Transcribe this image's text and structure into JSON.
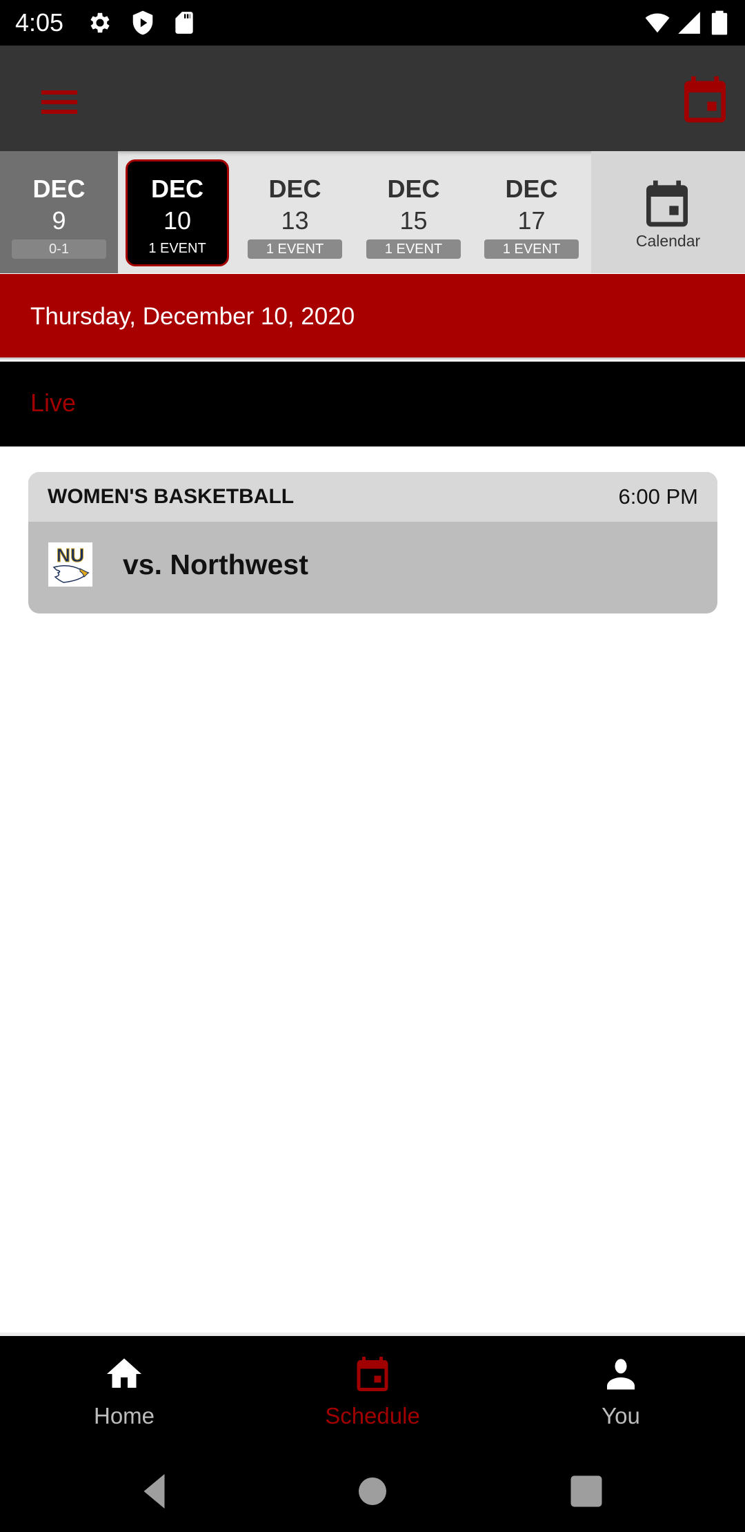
{
  "status_bar": {
    "time": "4:05",
    "left_icons": [
      "gear-icon",
      "shield-play-icon",
      "sd-card-icon"
    ],
    "right_icons": [
      "wifi-icon",
      "signal-icon",
      "battery-icon"
    ]
  },
  "header": {
    "menu_icon": "hamburger-menu-icon",
    "calendar_icon": "calendar-icon",
    "accent_color": "#a50000"
  },
  "date_strip": {
    "dates": [
      {
        "month": "DEC",
        "day": "9",
        "badge": "0-1",
        "state": "past"
      },
      {
        "month": "DEC",
        "day": "10",
        "badge": "1 EVENT",
        "state": "selected"
      },
      {
        "month": "DEC",
        "day": "13",
        "badge": "1 EVENT",
        "state": "upcoming"
      },
      {
        "month": "DEC",
        "day": "15",
        "badge": "1 EVENT",
        "state": "upcoming"
      },
      {
        "month": "DEC",
        "day": "17",
        "badge": "1 EVENT",
        "state": "upcoming"
      }
    ],
    "calendar_label": "Calendar"
  },
  "date_banner": {
    "text": "Thursday, December 10, 2020"
  },
  "live_bar": {
    "label": "Live"
  },
  "events": [
    {
      "sport": "WOMEN'S BASKETBALL",
      "time": "6:00 PM",
      "opponent": "vs. Northwest",
      "logo_text": "NU"
    }
  ],
  "bottom_nav": {
    "items": [
      {
        "label": "Home",
        "icon": "home-icon",
        "active": false
      },
      {
        "label": "Schedule",
        "icon": "calendar-icon",
        "active": true
      },
      {
        "label": "You",
        "icon": "person-icon",
        "active": false
      }
    ]
  },
  "system_nav": {
    "buttons": [
      "back-icon",
      "home-circle-icon",
      "recents-icon"
    ]
  }
}
